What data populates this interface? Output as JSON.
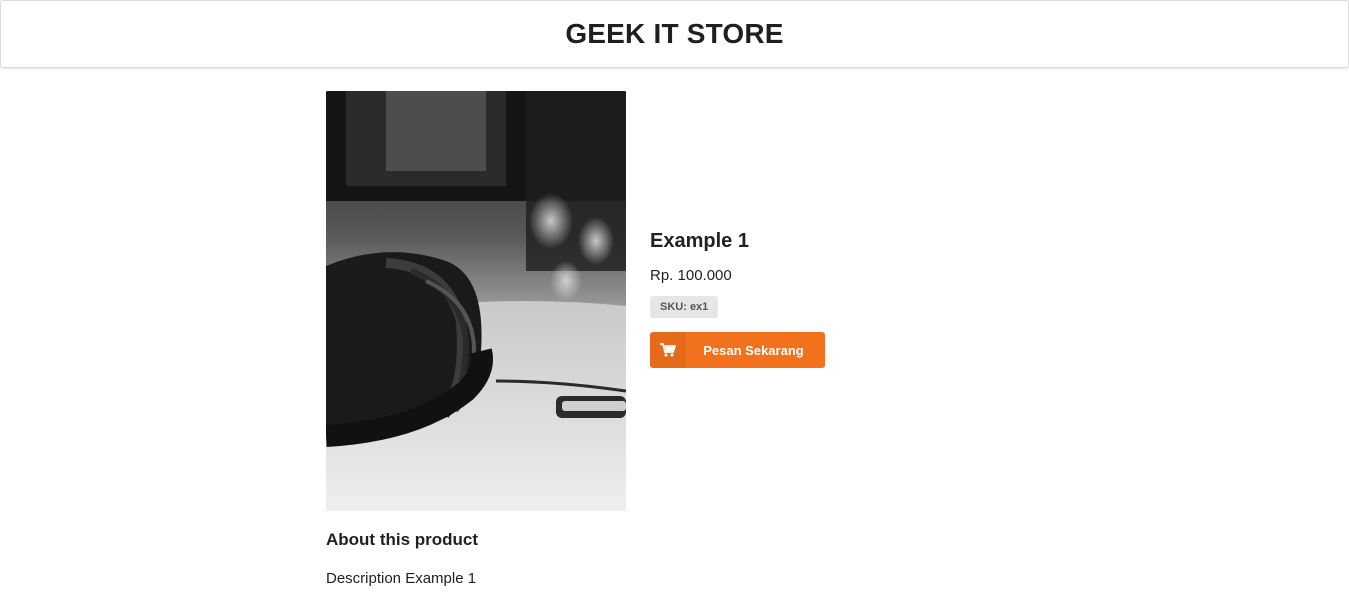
{
  "store": {
    "title": "GEEK IT STORE"
  },
  "product": {
    "image": {
      "icon": "headphones-photo",
      "tone": "grayscale"
    },
    "name": "Example 1",
    "price": "Rp. 100.000",
    "sku": "SKU: ex1",
    "order_button": {
      "label": "Pesan Sekarang",
      "icon": "cart-icon",
      "color": "#f2711c"
    },
    "about_title": "About this product",
    "description": "Description Example 1"
  }
}
